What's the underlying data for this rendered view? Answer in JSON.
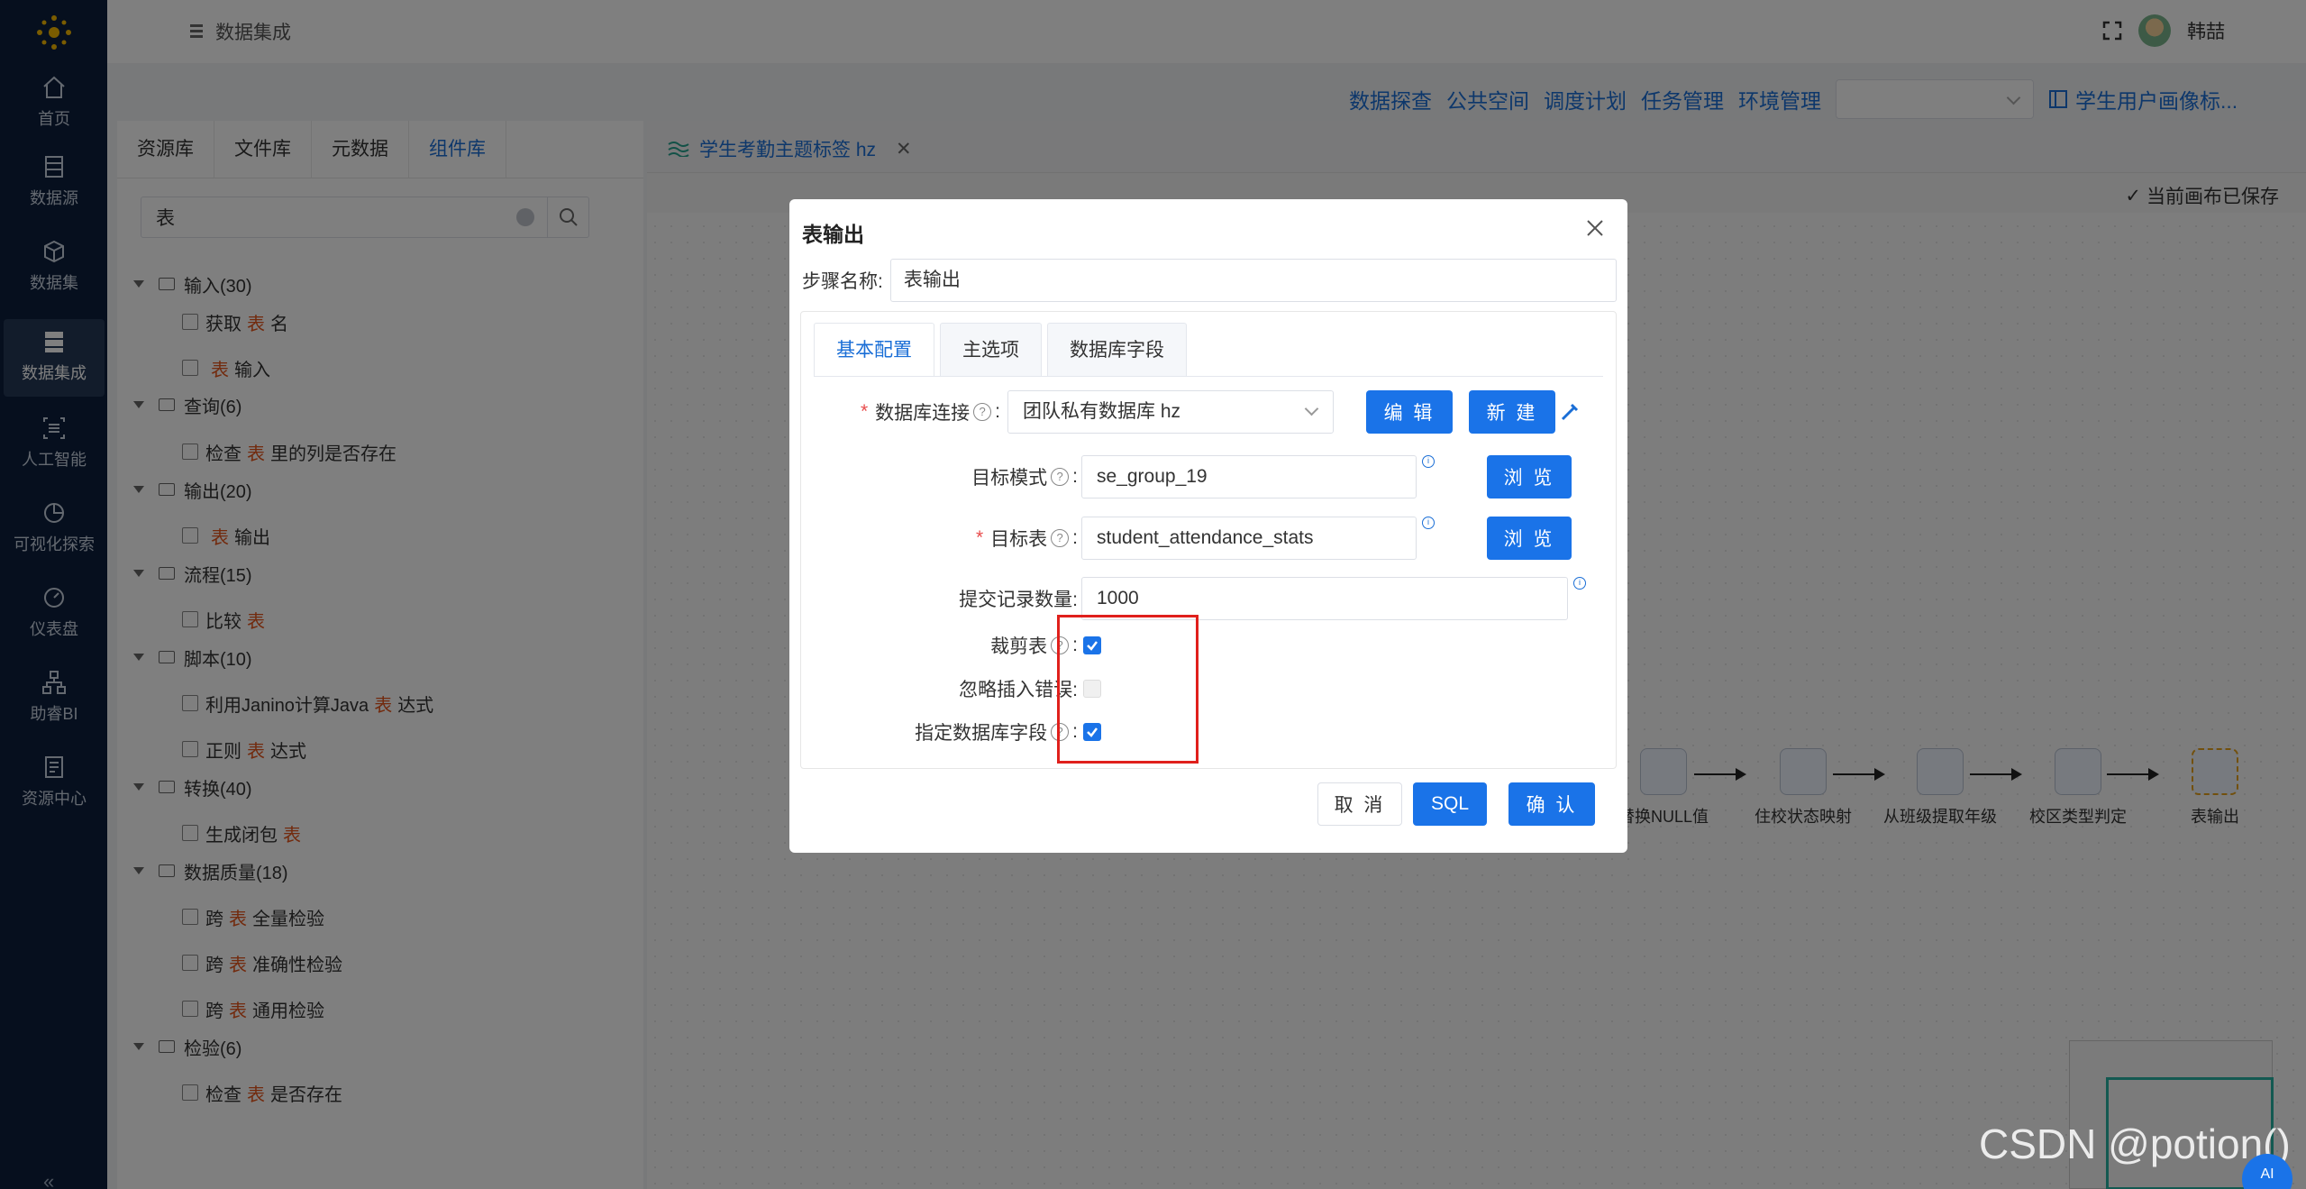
{
  "nav": {
    "items": [
      {
        "label": "首页",
        "icon": "home-icon"
      },
      {
        "label": "数据源",
        "icon": "database-icon"
      },
      {
        "label": "数据集",
        "icon": "cube-icon"
      },
      {
        "label": "数据集成",
        "icon": "server-icon"
      },
      {
        "label": "人工智能",
        "icon": "ai-icon"
      },
      {
        "label": "可视化探索",
        "icon": "pie-icon"
      },
      {
        "label": "仪表盘",
        "icon": "gauge-icon"
      },
      {
        "label": "助睿BI",
        "icon": "org-icon"
      },
      {
        "label": "资源中心",
        "icon": "resource-icon"
      }
    ],
    "active_index": 3
  },
  "header": {
    "breadcrumb": "数据集成",
    "username": "韩喆"
  },
  "subnav": {
    "links": [
      "数据探查",
      "公共空间",
      "调度计划",
      "任务管理",
      "环境管理"
    ],
    "profile": "学生用户画像标..."
  },
  "left_panel": {
    "tabs": [
      "资源库",
      "文件库",
      "元数据",
      "组件库"
    ],
    "active_tab": 3,
    "search_value": "表",
    "tree": [
      {
        "type": "group",
        "label": "输入(30)"
      },
      {
        "type": "leaf",
        "pre": "获取",
        "hl": "表",
        "post": "名"
      },
      {
        "type": "leaf",
        "pre": "",
        "hl": "表",
        "post": "输入"
      },
      {
        "type": "group",
        "label": "查询(6)"
      },
      {
        "type": "leaf",
        "pre": "检查",
        "hl": "表",
        "post": "里的列是否存在"
      },
      {
        "type": "group",
        "label": "输出(20)"
      },
      {
        "type": "leaf",
        "pre": "",
        "hl": "表",
        "post": "输出"
      },
      {
        "type": "group",
        "label": "流程(15)"
      },
      {
        "type": "leaf",
        "pre": "比较",
        "hl": "表",
        "post": ""
      },
      {
        "type": "group",
        "label": "脚本(10)"
      },
      {
        "type": "leaf",
        "pre": "利用Janino计算Java",
        "hl": "表",
        "post": "达式"
      },
      {
        "type": "leaf",
        "pre": "正则",
        "hl": "表",
        "post": "达式"
      },
      {
        "type": "group",
        "label": "转换(40)"
      },
      {
        "type": "leaf",
        "pre": "生成闭包",
        "hl": "表",
        "post": ""
      },
      {
        "type": "group",
        "label": "数据质量(18)"
      },
      {
        "type": "leaf",
        "pre": "跨",
        "hl": "表",
        "post": "全量检验"
      },
      {
        "type": "leaf",
        "pre": "跨",
        "hl": "表",
        "post": "准确性检验"
      },
      {
        "type": "leaf",
        "pre": "跨",
        "hl": "表",
        "post": "通用检验"
      },
      {
        "type": "group",
        "label": "检验(6)"
      },
      {
        "type": "leaf",
        "pre": "检查",
        "hl": "表",
        "post": "是否存在"
      }
    ]
  },
  "canvas": {
    "tab_title": "学生考勤主题标签 hz",
    "saved_text": "当前画布已保存",
    "nodes": [
      "替换NULL值",
      "住校状态映射",
      "从班级提取年级",
      "校区类型判定",
      "表输出"
    ]
  },
  "modal": {
    "title": "表输出",
    "step_name_label": "步骤名称:",
    "step_name_value": "表输出",
    "tabs": [
      "基本配置",
      "主选项",
      "数据库字段"
    ],
    "active_tab": 0,
    "db_conn_label": "数据库连接",
    "db_conn_value": "团队私有数据库 hz",
    "edit_btn": "编 辑",
    "new_btn": "新 建",
    "schema_label": "目标模式",
    "schema_value": "se_group_19",
    "browse_btn": "浏 览",
    "table_label": "目标表",
    "table_value": "student_attendance_stats",
    "commit_label": "提交记录数量:",
    "commit_value": "1000",
    "truncate_label": "裁剪表",
    "truncate_checked": true,
    "ignore_label": "忽略插入错误:",
    "ignore_checked": false,
    "specify_label": "指定数据库字段",
    "specify_checked": true,
    "cancel_btn": "取 消",
    "sql_btn": "SQL",
    "confirm_btn": "确 认"
  },
  "watermark": "CSDN @potion()",
  "ai_badge": "AI",
  "colors": {
    "primary": "#1a73e8",
    "nav_bg": "#0c1f3d",
    "highlight": "#e4541b",
    "annotation_red": "#e0201c"
  }
}
